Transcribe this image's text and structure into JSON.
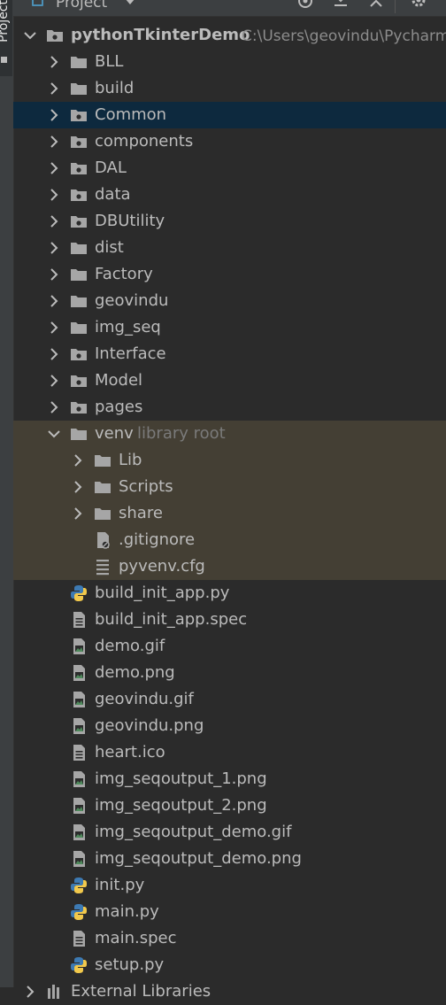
{
  "side_tab": {
    "label": "Project"
  },
  "header": {
    "title": "Project"
  },
  "project_root": {
    "name": "pythonTkinterDemo",
    "path": "C:\\Users\\geovindu\\Pycharm"
  },
  "folders": [
    {
      "label": "BLL",
      "kind": "folder"
    },
    {
      "label": "build",
      "kind": "folder"
    },
    {
      "label": "Common",
      "kind": "package",
      "selected": true
    },
    {
      "label": "components",
      "kind": "package"
    },
    {
      "label": "DAL",
      "kind": "package"
    },
    {
      "label": "data",
      "kind": "package"
    },
    {
      "label": "DBUtility",
      "kind": "package"
    },
    {
      "label": "dist",
      "kind": "folder"
    },
    {
      "label": "Factory",
      "kind": "folder"
    },
    {
      "label": "geovindu",
      "kind": "folder"
    },
    {
      "label": "img_seq",
      "kind": "folder"
    },
    {
      "label": "Interface",
      "kind": "package"
    },
    {
      "label": "Model",
      "kind": "package"
    },
    {
      "label": "pages",
      "kind": "package"
    }
  ],
  "venv": {
    "label": "venv",
    "hint": "library root",
    "children": [
      {
        "label": "Lib",
        "kind": "folder"
      },
      {
        "label": "Scripts",
        "kind": "folder"
      },
      {
        "label": "share",
        "kind": "folder"
      },
      {
        "label": ".gitignore",
        "kind": "ignore-file"
      },
      {
        "label": "pyvenv.cfg",
        "kind": "config-file"
      }
    ]
  },
  "files": [
    {
      "label": "build_init_app.py",
      "kind": "python"
    },
    {
      "label": "build_init_app.spec",
      "kind": "text"
    },
    {
      "label": "demo.gif",
      "kind": "image"
    },
    {
      "label": "demo.png",
      "kind": "image"
    },
    {
      "label": "geovindu.gif",
      "kind": "image"
    },
    {
      "label": "geovindu.png",
      "kind": "image"
    },
    {
      "label": "heart.ico",
      "kind": "text"
    },
    {
      "label": "img_seqoutput_1.png",
      "kind": "image"
    },
    {
      "label": "img_seqoutput_2.png",
      "kind": "image"
    },
    {
      "label": "img_seqoutput_demo.gif",
      "kind": "image"
    },
    {
      "label": "img_seqoutput_demo.png",
      "kind": "image"
    },
    {
      "label": "init.py",
      "kind": "python"
    },
    {
      "label": "main.py",
      "kind": "python"
    },
    {
      "label": "main.spec",
      "kind": "text"
    },
    {
      "label": "setup.py",
      "kind": "python"
    }
  ],
  "footer_item": {
    "label": "External Libraries",
    "kind": "libraries"
  },
  "colors": {
    "background": "#2b2b2b",
    "selection": "#0d293e",
    "library_root_bg": "#443f34",
    "folder_icon": "#a6a6a6",
    "python_blue": "#3d7ab3",
    "python_yellow": "#f2c94c"
  }
}
